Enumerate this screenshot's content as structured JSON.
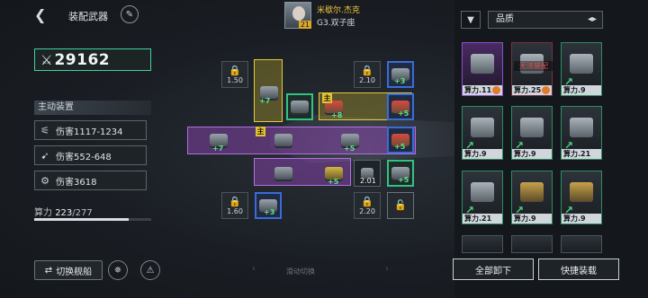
{
  "header": {
    "title": "装配武器",
    "back_icon": "back-arrow-icon",
    "edit_icon": "pen-icon"
  },
  "pilot": {
    "name": "米歇尔.杰克",
    "level": "21",
    "class": "G3.双子座"
  },
  "combat_power": "29162",
  "active_equipment": {
    "label": "主动装置",
    "stats": [
      {
        "icon": "claw-icon",
        "text": "伤害1117-1234"
      },
      {
        "icon": "missile-icon",
        "text": "伤害552-648"
      },
      {
        "icon": "gear-icon",
        "text": "伤害3618"
      }
    ]
  },
  "energy": {
    "label": "算力",
    "current": "223",
    "max": "/277",
    "fraction": 0.805
  },
  "bottom": {
    "switch_ship": "切换舰船",
    "swipe_hint": "滑动切换"
  },
  "grid": {
    "locks": [
      {
        "value": "1.50"
      },
      {
        "value": "2.10"
      },
      {
        "value": "1.60"
      },
      {
        "value": "2.20"
      },
      {
        "value": ""
      }
    ],
    "slot_values": {
      "mid": "2.01"
    },
    "main_tag": "主",
    "pluses": [
      "+7",
      "+3",
      "+8",
      "+5",
      "+7",
      "+5",
      "+5",
      "+5",
      "+5",
      "+3"
    ]
  },
  "panel": {
    "quality_label": "品质",
    "cards": [
      {
        "label": "算力.11",
        "warn": ""
      },
      {
        "label": "算力.25",
        "warn": "无法装配"
      },
      {
        "label": "算力.9",
        "warn": ""
      },
      {
        "label": "算力.9",
        "warn": ""
      },
      {
        "label": "算力.9",
        "warn": ""
      },
      {
        "label": "算力.21",
        "warn": ""
      },
      {
        "label": "算力.21",
        "warn": ""
      },
      {
        "label": "算力.9",
        "warn": ""
      },
      {
        "label": "算力.9",
        "warn": ""
      }
    ],
    "unload_all": "全部卸下",
    "quick_equip": "快捷装载"
  },
  "colors": {
    "accent_green": "#3fd1a4",
    "purple": "#b070e0",
    "yellow": "#e2cb3a",
    "blue": "#3a6cd8"
  }
}
